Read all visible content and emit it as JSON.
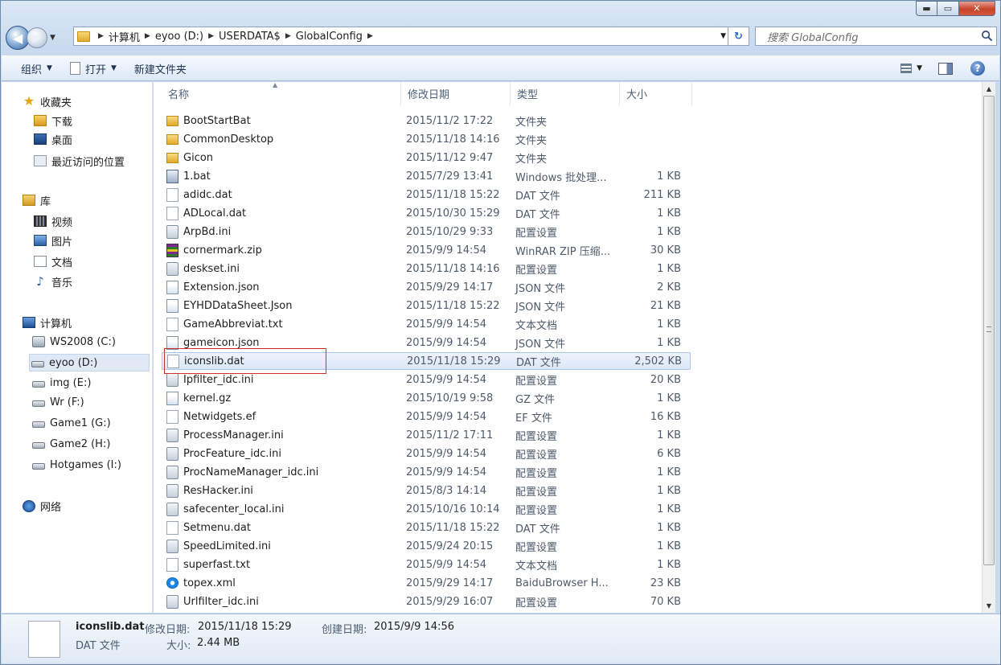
{
  "window": {
    "caption": {
      "minimize": "▬",
      "maximize": "▭",
      "close": "✕"
    }
  },
  "navbar": {
    "breadcrumbs": [
      "计算机",
      "eyoo (D:)",
      "USERDATA$",
      "GlobalConfig"
    ],
    "search_placeholder": "搜索 GlobalConfig"
  },
  "toolbar": {
    "organize": "组织",
    "open": "打开",
    "new_folder": "新建文件夹"
  },
  "navpane": {
    "favorites": "收藏夹",
    "fav_items": [
      "下载",
      "桌面",
      "最近访问的位置"
    ],
    "libraries": "库",
    "lib_items": [
      "视频",
      "图片",
      "文档",
      "音乐"
    ],
    "computer": "计算机",
    "drives": [
      "WS2008 (C:)",
      "eyoo (D:)",
      "img (E:)",
      "Wr (F:)",
      "Game1 (G:)",
      "Game2 (H:)",
      "Hotgames (I:)"
    ],
    "network": "网络"
  },
  "filelist": {
    "columns": {
      "name": "名称",
      "date": "修改日期",
      "type": "类型",
      "size": "大小"
    },
    "rows": [
      {
        "name": "BootStartBat",
        "date": "2015/11/2 17:22",
        "type": "文件夹",
        "size": "",
        "icon": "folder"
      },
      {
        "name": "CommonDesktop",
        "date": "2015/11/18 14:16",
        "type": "文件夹",
        "size": "",
        "icon": "folder"
      },
      {
        "name": "Gicon",
        "date": "2015/11/12 9:47",
        "type": "文件夹",
        "size": "",
        "icon": "folder"
      },
      {
        "name": "1.bat",
        "date": "2015/7/29 13:41",
        "type": "Windows 批处理...",
        "size": "1 KB",
        "icon": "bat"
      },
      {
        "name": "adidc.dat",
        "date": "2015/11/18 15:22",
        "type": "DAT 文件",
        "size": "211 KB",
        "icon": "file"
      },
      {
        "name": "ADLocal.dat",
        "date": "2015/10/30 15:29",
        "type": "DAT 文件",
        "size": "1 KB",
        "icon": "file"
      },
      {
        "name": "ArpBd.ini",
        "date": "2015/10/29 9:33",
        "type": "配置设置",
        "size": "1 KB",
        "icon": "ini"
      },
      {
        "name": "cornermark.zip",
        "date": "2015/9/9 14:54",
        "type": "WinRAR ZIP 压缩...",
        "size": "30 KB",
        "icon": "zip"
      },
      {
        "name": "deskset.ini",
        "date": "2015/11/18 14:16",
        "type": "配置设置",
        "size": "1 KB",
        "icon": "ini"
      },
      {
        "name": "Extension.json",
        "date": "2015/9/29 14:17",
        "type": "JSON 文件",
        "size": "2 KB",
        "icon": "json"
      },
      {
        "name": "EYHDDataSheet.Json",
        "date": "2015/11/18 15:22",
        "type": "JSON 文件",
        "size": "21 KB",
        "icon": "json"
      },
      {
        "name": "GameAbbreviat.txt",
        "date": "2015/9/9 14:54",
        "type": "文本文档",
        "size": "1 KB",
        "icon": "file"
      },
      {
        "name": "gameicon.json",
        "date": "2015/9/9 14:54",
        "type": "JSON 文件",
        "size": "1 KB",
        "icon": "json"
      },
      {
        "name": "iconslib.dat",
        "date": "2015/11/18 15:29",
        "type": "DAT 文件",
        "size": "2,502 KB",
        "icon": "file",
        "selected": true
      },
      {
        "name": "Ipfilter_idc.ini",
        "date": "2015/9/9 14:54",
        "type": "配置设置",
        "size": "20 KB",
        "icon": "ini"
      },
      {
        "name": "kernel.gz",
        "date": "2015/10/19 9:58",
        "type": "GZ 文件",
        "size": "1 KB",
        "icon": "json"
      },
      {
        "name": "Netwidgets.ef",
        "date": "2015/9/9 14:54",
        "type": "EF 文件",
        "size": "16 KB",
        "icon": "file"
      },
      {
        "name": "ProcessManager.ini",
        "date": "2015/11/2 17:11",
        "type": "配置设置",
        "size": "1 KB",
        "icon": "ini"
      },
      {
        "name": "ProcFeature_idc.ini",
        "date": "2015/9/9 14:54",
        "type": "配置设置",
        "size": "6 KB",
        "icon": "ini"
      },
      {
        "name": "ProcNameManager_idc.ini",
        "date": "2015/9/9 14:54",
        "type": "配置设置",
        "size": "1 KB",
        "icon": "ini"
      },
      {
        "name": "ResHacker.ini",
        "date": "2015/8/3 14:14",
        "type": "配置设置",
        "size": "1 KB",
        "icon": "ini"
      },
      {
        "name": "safecenter_local.ini",
        "date": "2015/10/16 10:14",
        "type": "配置设置",
        "size": "1 KB",
        "icon": "ini"
      },
      {
        "name": "Setmenu.dat",
        "date": "2015/11/18 15:22",
        "type": "DAT 文件",
        "size": "1 KB",
        "icon": "file"
      },
      {
        "name": "SpeedLimited.ini",
        "date": "2015/9/24 20:15",
        "type": "配置设置",
        "size": "1 KB",
        "icon": "ini"
      },
      {
        "name": "superfast.txt",
        "date": "2015/9/9 14:54",
        "type": "文本文档",
        "size": "1 KB",
        "icon": "file"
      },
      {
        "name": "topex.xml",
        "date": "2015/9/29 14:17",
        "type": "BaiduBrowser H...",
        "size": "23 KB",
        "icon": "xml"
      },
      {
        "name": "Urlfilter_idc.ini",
        "date": "2015/9/29 16:07",
        "type": "配置设置",
        "size": "70 KB",
        "icon": "ini"
      }
    ]
  },
  "details": {
    "name": "iconslib.dat",
    "type": "DAT 文件",
    "modified_label": "修改日期:",
    "modified_value": "2015/11/18 15:29",
    "created_label": "创建日期:",
    "created_value": "2015/9/9 14:56",
    "size_label": "大小:",
    "size_value": "2.44 MB"
  }
}
